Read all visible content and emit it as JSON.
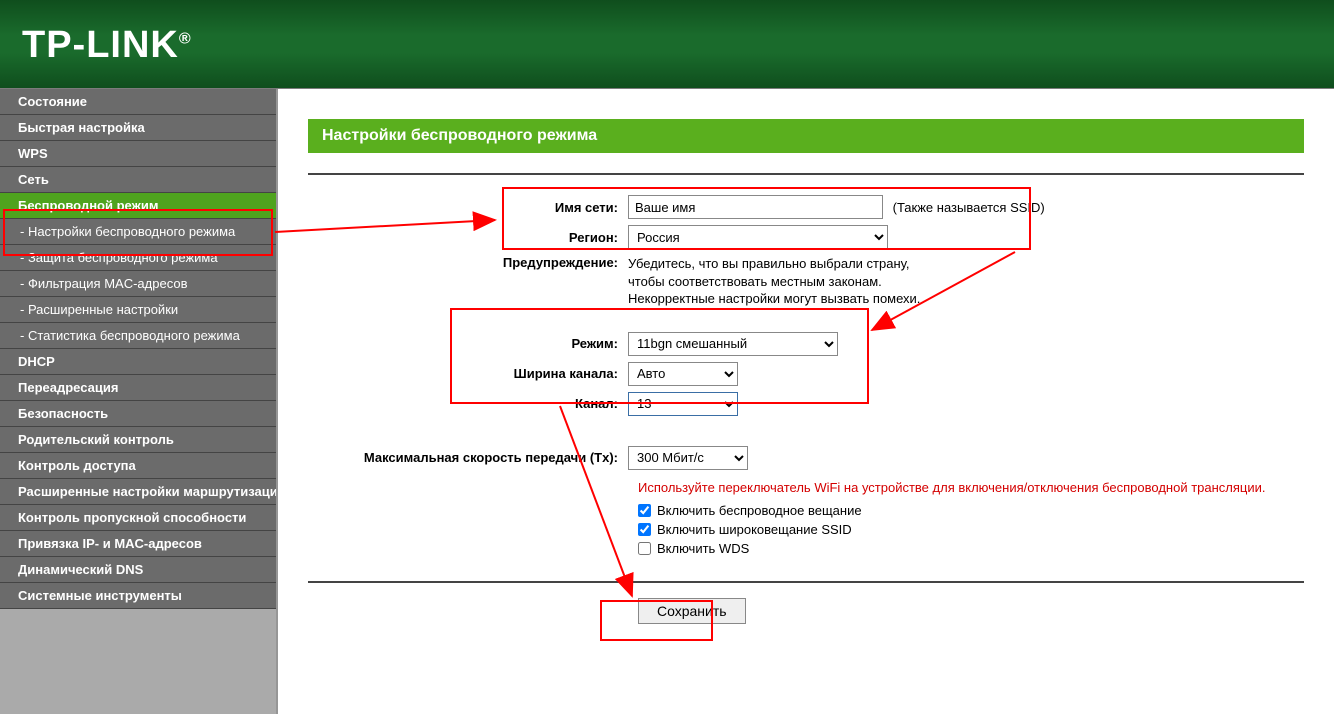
{
  "brand": "TP-LINK",
  "page_title": "Настройки беспроводного режима",
  "sidebar": {
    "items": [
      {
        "label": "Состояние"
      },
      {
        "label": "Быстрая настройка"
      },
      {
        "label": "WPS"
      },
      {
        "label": "Сеть"
      },
      {
        "label": "Беспроводной режим",
        "active": true,
        "sub": [
          {
            "label": "- Настройки беспроводного режима",
            "active": true
          },
          {
            "label": "- Защита беспроводного режима"
          },
          {
            "label": "- Фильтрация MAC-адресов"
          },
          {
            "label": "- Расширенные настройки"
          },
          {
            "label": "- Статистика беспроводного режима"
          }
        ]
      },
      {
        "label": "DHCP"
      },
      {
        "label": "Переадресация"
      },
      {
        "label": "Безопасность"
      },
      {
        "label": "Родительский контроль"
      },
      {
        "label": "Контроль доступа"
      },
      {
        "label": "Расширенные настройки маршрутизации"
      },
      {
        "label": "Контроль пропускной способности"
      },
      {
        "label": "Привязка IP- и MAC-адресов"
      },
      {
        "label": "Динамический DNS"
      },
      {
        "label": "Системные инструменты"
      }
    ]
  },
  "form": {
    "ssid_label": "Имя сети:",
    "ssid_value": "Ваше имя",
    "ssid_hint": "(Также называется SSID)",
    "region_label": "Регион:",
    "region_value": "Россия",
    "warning_label": "Предупреждение:",
    "warning_line1": "Убедитесь, что вы правильно выбрали страну,",
    "warning_line2": "чтобы соответствовать местным законам.",
    "warning_line3": "Некорректные настройки могут вызвать помехи.",
    "mode_label": "Режим:",
    "mode_value": "11bgn смешанный",
    "width_label": "Ширина канала:",
    "width_value": "Авто",
    "channel_label": "Канал:",
    "channel_value": "13",
    "txrate_label": "Максимальная скорость передачи (Tx):",
    "txrate_value": "300 Мбит/с",
    "wifi_switch_hint": "Используйте переключатель WiFi на устройстве для включения/отключения беспроводной трансляции.",
    "enable_radio_label": "Включить беспроводное вещание",
    "enable_ssid_label": "Включить широковещание SSID",
    "enable_wds_label": "Включить WDS",
    "save_label": "Сохранить"
  }
}
